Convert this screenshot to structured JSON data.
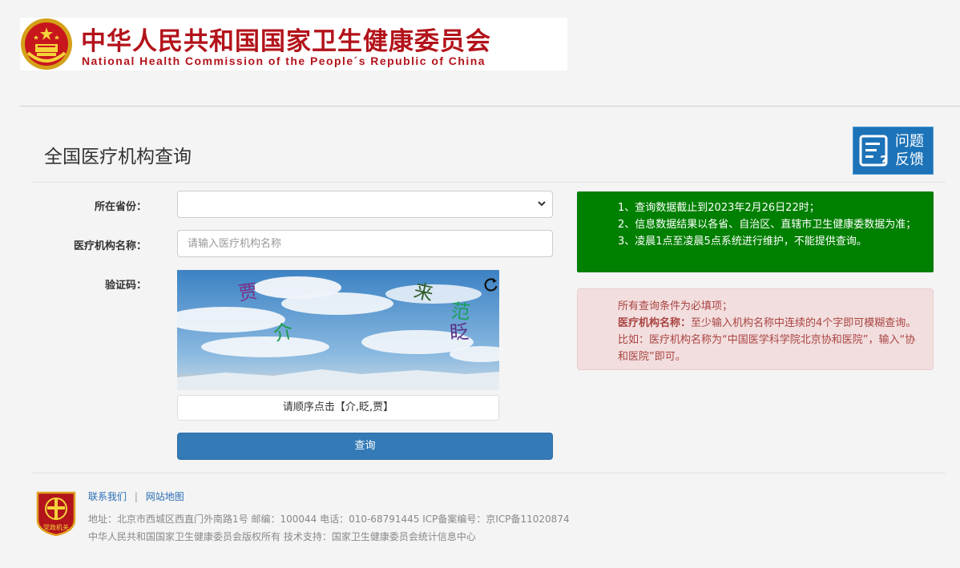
{
  "header": {
    "title_zh": "中华人民共和国国家卫生健康委员会",
    "title_en": "National Health Commission of the People´s Republic of China"
  },
  "page": {
    "title": "全国医疗机构查询",
    "feedback_line1": "问题",
    "feedback_line2": "反馈"
  },
  "form": {
    "province_label": "所在省份：",
    "province_value": "",
    "name_label": "医疗机构名称：",
    "name_placeholder": "请输入医疗机构名称",
    "captcha_label": "验证码：",
    "captcha_chars": [
      "贾",
      "来",
      "介",
      "范",
      "眨"
    ],
    "captcha_hint": "请顺序点击【介,眨,贾】",
    "submit_label": "查询"
  },
  "notice_info": {
    "line1": "1、查询数据截止到2023年2月26日22时；",
    "line2": "2、信息数据结果以各省、自治区、直辖市卫生健康委数据为准；",
    "line3": "3、凌晨1点至凌晨5点系统进行维护，不能提供查询。"
  },
  "notice_required": {
    "line1": "所有查询条件为必填项；",
    "bold_label": "医疗机构名称：",
    "line2": "至少输入机构名称中连续的4个字即可模糊查询。比如：医疗机构名称为“中国医学科学院北京协和医院”，输入“协和医院”即可。"
  },
  "footer": {
    "link_contact": "联系我们",
    "separator": "|",
    "link_sitemap": "网站地图",
    "address_line": "地址：北京市西城区西直门外南路1号    邮编：100044    电话：010-68791445    ICP备案编号：京ICP备11020874",
    "copyright_line": "中华人民共和国国家卫生健康委员会版权所有    技术支持：国家卫生健康委员会统计信息中心",
    "badge_text": "党政机关"
  },
  "colors": {
    "brand_red": "#b3131b",
    "primary_blue": "#337ab7",
    "notice_green": "#008000",
    "notice_pink": "#f2dede"
  }
}
